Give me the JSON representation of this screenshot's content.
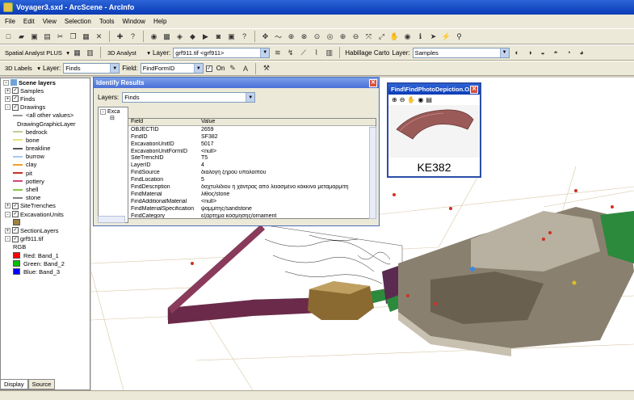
{
  "window": {
    "title": "Voyager3.sxd - ArcScene - ArcInfo"
  },
  "menu": [
    "File",
    "Edit",
    "View",
    "Selection",
    "Tools",
    "Window",
    "Help"
  ],
  "toolbar2": {
    "spatial_analyst": "Spatial Analyst PLUS",
    "analyst3d": "3D Analyst",
    "layer_label": "Layer:",
    "layer_value": "grf911.tif <grf911>",
    "habillage": "Habillage Carto",
    "layer2_label": "Layer:",
    "layer2_value": "Samples"
  },
  "toolbar3": {
    "labels3d": "3D Labels",
    "layer_label": "Layer:",
    "layer_value": "Finds",
    "field_label": "Field:",
    "field_value": "FindFormID",
    "on_label": "On"
  },
  "toc": {
    "title": "Scene layers",
    "items": [
      {
        "label": "Samples",
        "checked": true,
        "expand": "+",
        "indent": 1
      },
      {
        "label": "Finds",
        "checked": true,
        "expand": "+",
        "indent": 1
      },
      {
        "label": "Drawings",
        "checked": true,
        "expand": "-",
        "indent": 1
      },
      {
        "label": "<all other values>",
        "indent": 3,
        "symbol": "#999999"
      },
      {
        "label": "DrawingGraphicLayer",
        "indent": 4,
        "symbol": ""
      },
      {
        "label": "bedrock",
        "indent": 3,
        "symbol": "#c8c890"
      },
      {
        "label": "bone",
        "indent": 3,
        "symbol": "#e8e078"
      },
      {
        "label": "breakline",
        "indent": 3,
        "symbol": "#555555"
      },
      {
        "label": "burrow",
        "indent": 3,
        "symbol": "#a8c8f0"
      },
      {
        "label": "clay",
        "indent": 3,
        "symbol": "#f0a020"
      },
      {
        "label": "pit",
        "indent": 3,
        "symbol": "#c83020"
      },
      {
        "label": "pottery",
        "indent": 3,
        "symbol": "#d04870"
      },
      {
        "label": "shell",
        "indent": 3,
        "symbol": "#88c848"
      },
      {
        "label": "stone",
        "indent": 3,
        "symbol": "#808080"
      },
      {
        "label": "SiteTrenches",
        "checked": true,
        "expand": "+",
        "indent": 1
      },
      {
        "label": "ExcavationUnits",
        "checked": true,
        "expand": "-",
        "indent": 1
      },
      {
        "label": "",
        "indent": 3,
        "symbol": "#a08040",
        "box": true
      },
      {
        "label": "SectionLayers",
        "checked": true,
        "expand": "+",
        "indent": 1
      },
      {
        "label": "grf911.tif",
        "checked": true,
        "expand": "-",
        "indent": 1
      },
      {
        "label": "RGB",
        "indent": 3
      },
      {
        "label": "Red:   Band_1",
        "indent": 3,
        "symbol": "#ff0000",
        "box": true
      },
      {
        "label": "Green: Band_2",
        "indent": 3,
        "symbol": "#00c000",
        "box": true
      },
      {
        "label": "Blue:  Band_3",
        "indent": 3,
        "symbol": "#0000ff",
        "box": true
      }
    ]
  },
  "tabs": [
    "Display",
    "Source"
  ],
  "identify": {
    "title": "Identify Results",
    "layers_label": "Layers:",
    "layers_value": "Finds",
    "tree_node": "Exca",
    "col_field": "Field",
    "col_value": "Value",
    "rows": [
      [
        "OBJECTID",
        "2659"
      ],
      [
        "FindID",
        "SF382"
      ],
      [
        "ExcavationUnitID",
        "5017"
      ],
      [
        "ExcavationUnitFormID",
        "<null>"
      ],
      [
        "SiteTrenchID",
        "T5"
      ],
      [
        "LayerID",
        "4"
      ],
      [
        "FindSource",
        "διαλογή ξηρού υπολοίπου"
      ],
      [
        "FindLocation",
        "5"
      ],
      [
        "FindDescription",
        "δαχτυλίδιου ή χάντρας από λειασμένο κόκκινο μεταμαρμίτη"
      ],
      [
        "FindMaterial",
        "λίθος/stone"
      ],
      [
        "FindAdditionalMaterial",
        "<null>"
      ],
      [
        "FindMaterialSpecification",
        "ψαμμίτης/sandstone"
      ],
      [
        "FindCategory",
        "εξάρτημα κόσμησης/ornament"
      ]
    ]
  },
  "photo": {
    "title": "Find\\FindPhotoDepiction.O...",
    "caption": "KE382"
  }
}
